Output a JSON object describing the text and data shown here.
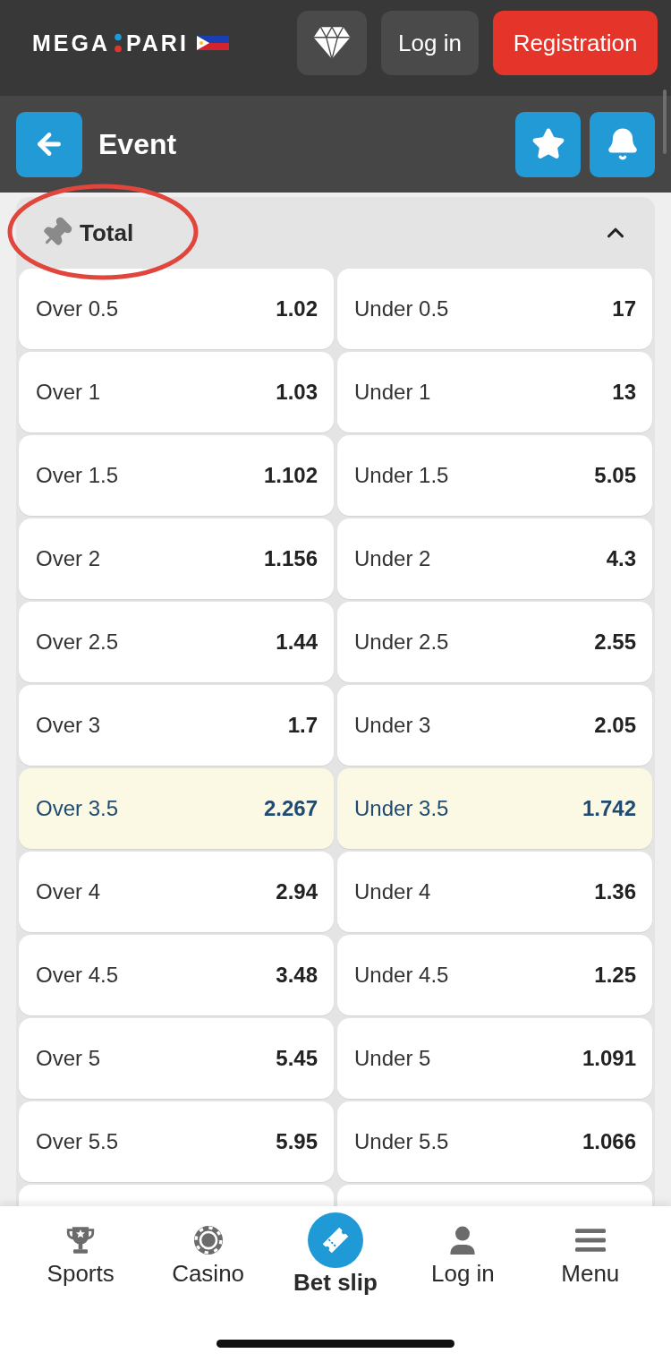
{
  "header": {
    "logo": [
      "MEGA",
      "PARI"
    ],
    "login": "Log in",
    "register": "Registration"
  },
  "page_bar": {
    "title": "Event"
  },
  "market": {
    "title": "Total",
    "expanded": true,
    "rows": [
      {
        "highlighted": false,
        "over": {
          "label": "Over 0.5",
          "odds": "1.02"
        },
        "under": {
          "label": "Under 0.5",
          "odds": "17"
        }
      },
      {
        "highlighted": false,
        "over": {
          "label": "Over 1",
          "odds": "1.03"
        },
        "under": {
          "label": "Under 1",
          "odds": "13"
        }
      },
      {
        "highlighted": false,
        "over": {
          "label": "Over 1.5",
          "odds": "1.102"
        },
        "under": {
          "label": "Under 1.5",
          "odds": "5.05"
        }
      },
      {
        "highlighted": false,
        "over": {
          "label": "Over 2",
          "odds": "1.156"
        },
        "under": {
          "label": "Under 2",
          "odds": "4.3"
        }
      },
      {
        "highlighted": false,
        "over": {
          "label": "Over 2.5",
          "odds": "1.44"
        },
        "under": {
          "label": "Under 2.5",
          "odds": "2.55"
        }
      },
      {
        "highlighted": false,
        "over": {
          "label": "Over 3",
          "odds": "1.7"
        },
        "under": {
          "label": "Under 3",
          "odds": "2.05"
        }
      },
      {
        "highlighted": true,
        "over": {
          "label": "Over 3.5",
          "odds": "2.267"
        },
        "under": {
          "label": "Under 3.5",
          "odds": "1.742"
        }
      },
      {
        "highlighted": false,
        "over": {
          "label": "Over 4",
          "odds": "2.94"
        },
        "under": {
          "label": "Under 4",
          "odds": "1.36"
        }
      },
      {
        "highlighted": false,
        "over": {
          "label": "Over 4.5",
          "odds": "3.48"
        },
        "under": {
          "label": "Under 4.5",
          "odds": "1.25"
        }
      },
      {
        "highlighted": false,
        "over": {
          "label": "Over 5",
          "odds": "5.45"
        },
        "under": {
          "label": "Under 5",
          "odds": "1.091"
        }
      },
      {
        "highlighted": false,
        "over": {
          "label": "Over 5.5",
          "odds": "5.95"
        },
        "under": {
          "label": "Under 5.5",
          "odds": "1.066"
        }
      }
    ]
  },
  "bottom_nav": [
    {
      "label": "Sports",
      "selected": false
    },
    {
      "label": "Casino",
      "selected": false
    },
    {
      "label": "Bet slip",
      "selected": true
    },
    {
      "label": "Log in",
      "selected": false
    },
    {
      "label": "Menu",
      "selected": false
    }
  ]
}
